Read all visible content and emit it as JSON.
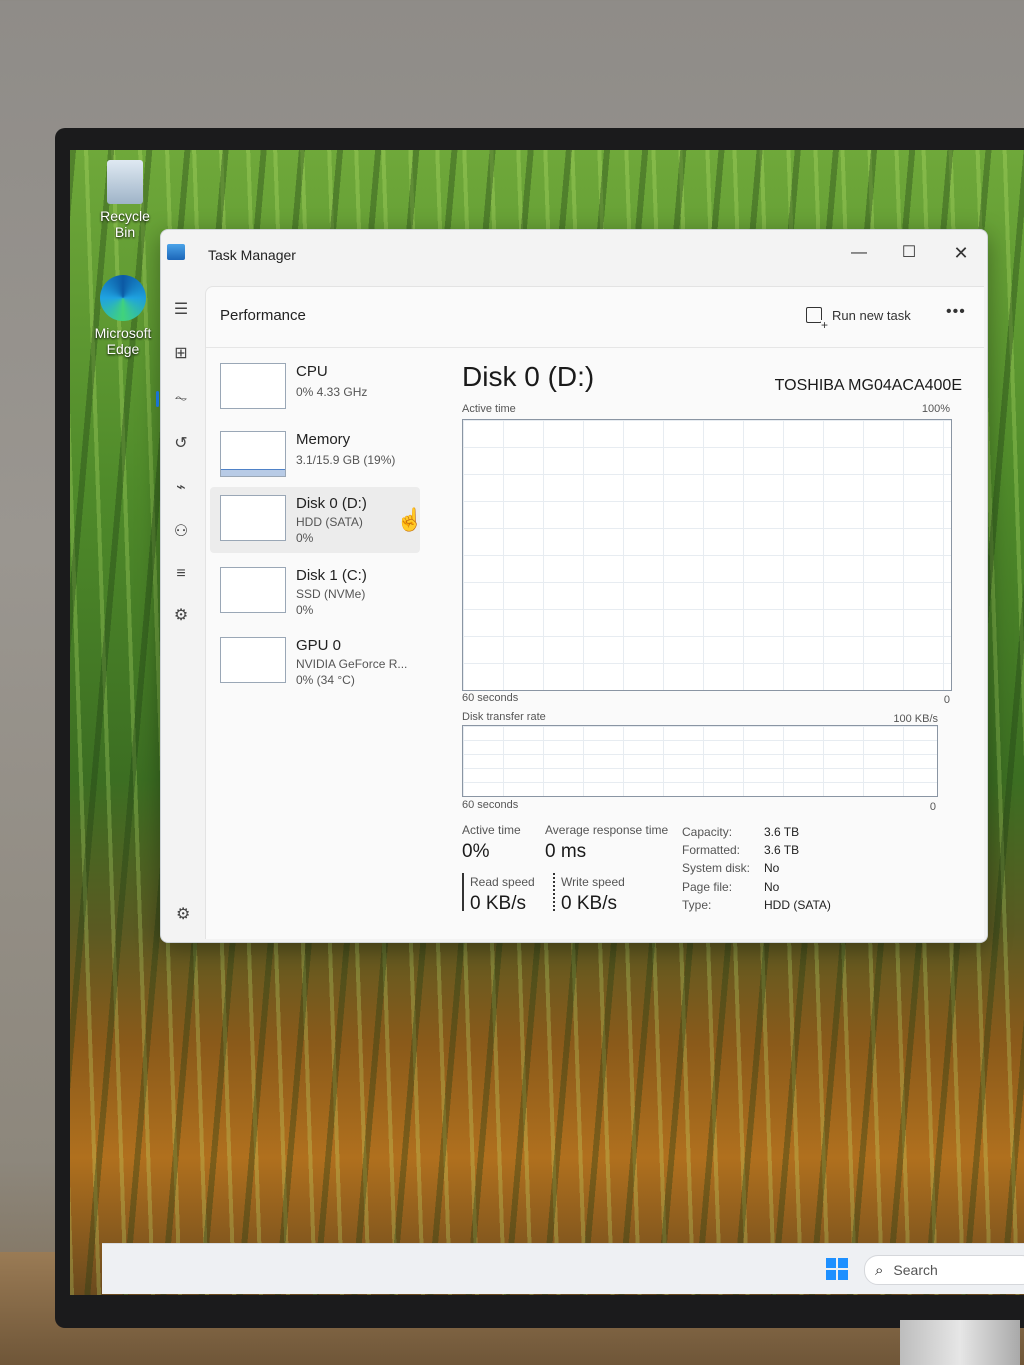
{
  "desktop": {
    "icons": [
      {
        "label": "Recycle Bin",
        "icon": "recycle-bin-icon"
      },
      {
        "label": "Microsoft Edge",
        "icon": "edge-icon"
      }
    ]
  },
  "taskbar": {
    "search_label": "Search",
    "start_icon": "windows-logo-icon"
  },
  "window": {
    "title": "Task Manager",
    "controls": {
      "minimize": "—",
      "maximize": "☐",
      "close": "✕"
    }
  },
  "nav": {
    "items": [
      {
        "name": "menu",
        "glyph": "☰"
      },
      {
        "name": "processes",
        "glyph": "⊞"
      },
      {
        "name": "performance",
        "glyph": "⏦",
        "active": true
      },
      {
        "name": "app-history",
        "glyph": "↺"
      },
      {
        "name": "startup-apps",
        "glyph": "⌁"
      },
      {
        "name": "users",
        "glyph": "⚇"
      },
      {
        "name": "details",
        "glyph": "≡"
      },
      {
        "name": "services",
        "glyph": "⚙"
      }
    ],
    "settings_glyph": "⚙"
  },
  "header": {
    "title": "Performance",
    "run_new_task": "Run new task",
    "more": "•••"
  },
  "devices": [
    {
      "name": "CPU",
      "line1": "0% 4.33 GHz",
      "line2": ""
    },
    {
      "name": "Memory",
      "line1": "3.1/15.9 GB (19%)",
      "line2": "",
      "usage_fraction": 0.19
    },
    {
      "name": "Disk 0 (D:)",
      "line1": "HDD (SATA)",
      "line2": "0%",
      "selected": true
    },
    {
      "name": "Disk 1 (C:)",
      "line1": "SSD (NVMe)",
      "line2": "0%"
    },
    {
      "name": "GPU 0",
      "line1": "NVIDIA GeForce R...",
      "line2": "0% (34 °C)"
    }
  ],
  "detail": {
    "title": "Disk 0 (D:)",
    "model": "TOSHIBA MG04ACA400E",
    "graph1": {
      "label": "Active time",
      "max": "100%",
      "x_label": "60 seconds",
      "min": "0"
    },
    "graph2": {
      "label": "Disk transfer rate",
      "max": "100 KB/s",
      "x_label": "60 seconds",
      "min": "0"
    },
    "stats": {
      "active_time_label": "Active time",
      "active_time_value": "0%",
      "avg_response_label": "Average response time",
      "avg_response_value": "0 ms",
      "read_label": "Read speed",
      "read_value": "0 KB/s",
      "write_label": "Write speed",
      "write_value": "0 KB/s"
    },
    "properties": [
      {
        "key": "Capacity:",
        "value": "3.6 TB"
      },
      {
        "key": "Formatted:",
        "value": "3.6 TB"
      },
      {
        "key": "System disk:",
        "value": "No"
      },
      {
        "key": "Page file:",
        "value": "No"
      },
      {
        "key": "Type:",
        "value": "HDD (SATA)"
      }
    ]
  }
}
